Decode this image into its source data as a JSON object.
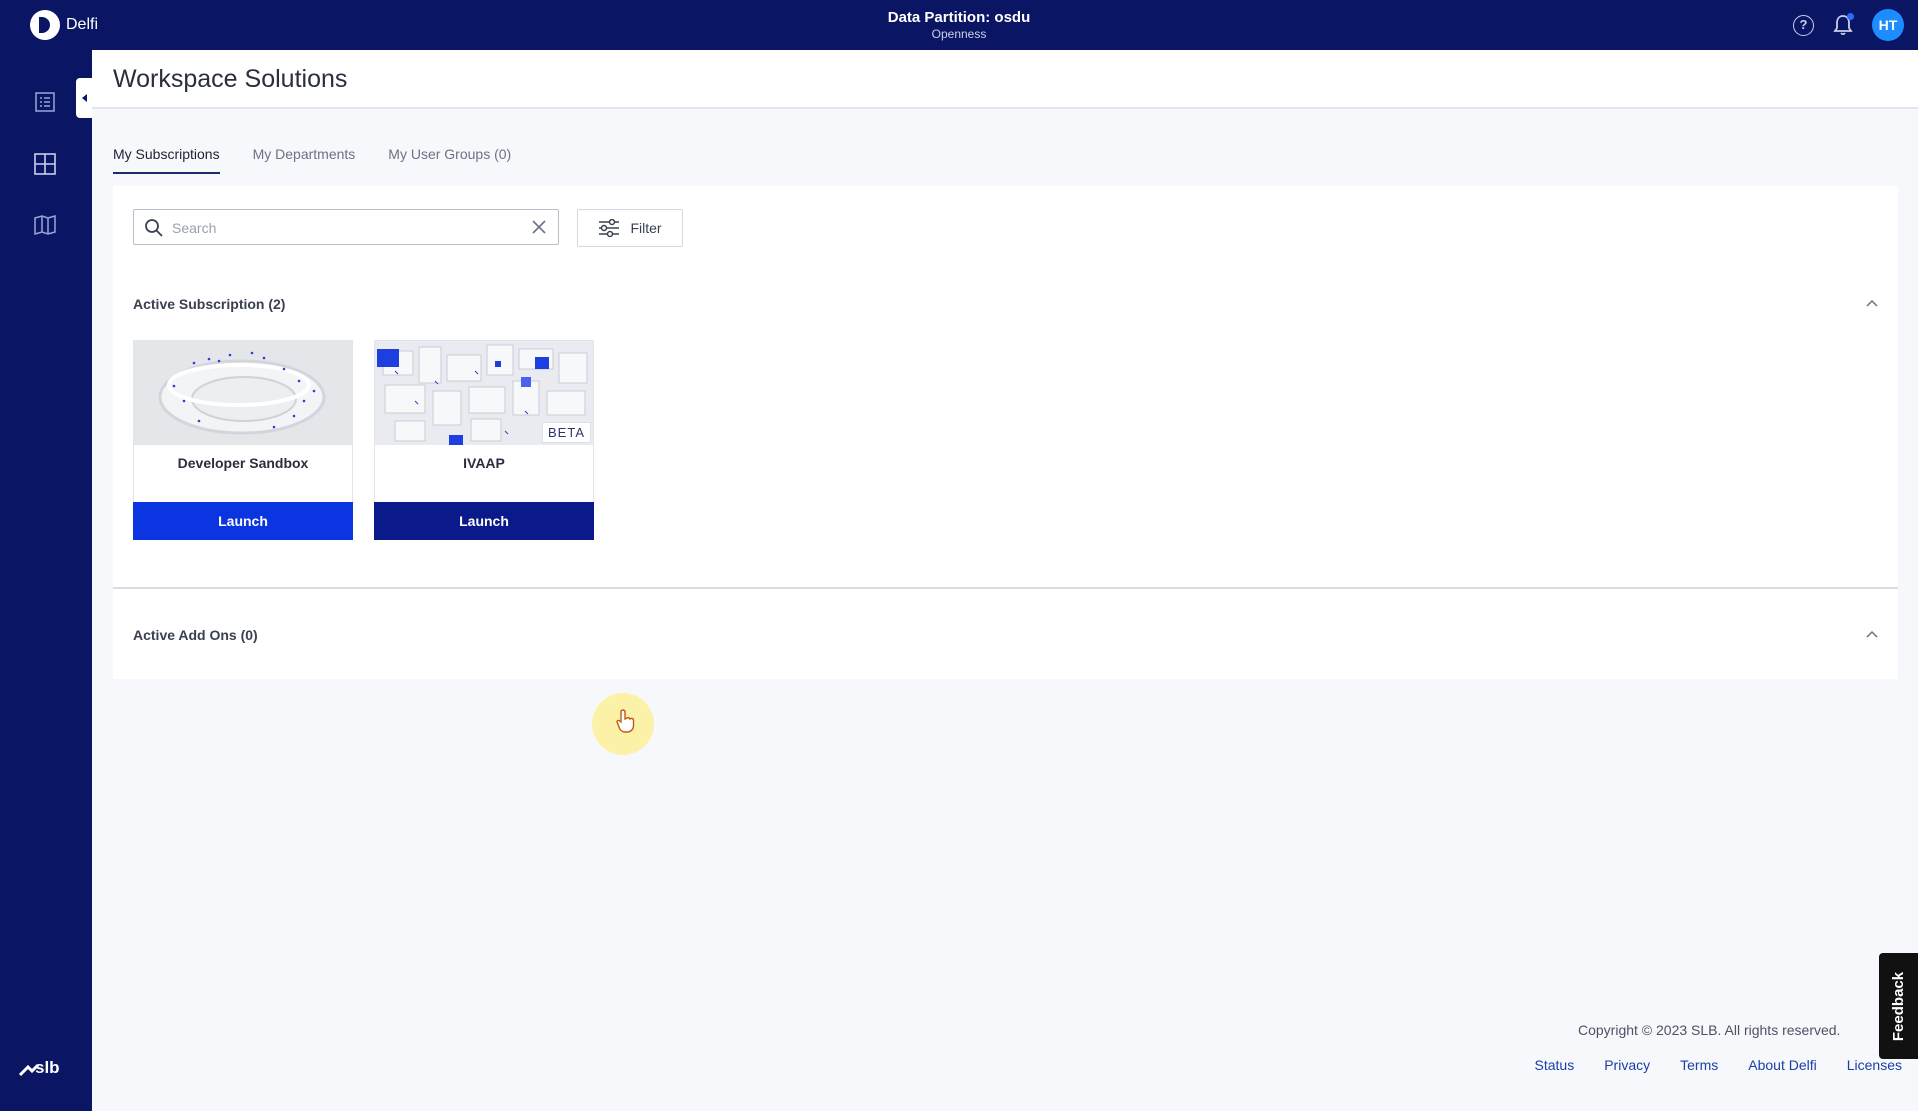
{
  "app": {
    "name": "Delfi"
  },
  "topbar": {
    "partition_title": "Data Partition: osdu",
    "partition_subtitle": "Openness",
    "avatar_initials": "HT"
  },
  "sidebar": {
    "items": [
      {
        "name": "list",
        "icon": "list-icon"
      },
      {
        "name": "grid",
        "icon": "grid-icon"
      },
      {
        "name": "book",
        "icon": "book-icon"
      }
    ],
    "footer_logo": "slb-logo"
  },
  "page": {
    "title": "Workspace Solutions"
  },
  "tabs": [
    {
      "label": "My Subscriptions",
      "active": true
    },
    {
      "label": "My Departments",
      "active": false
    },
    {
      "label": "My User Groups (0)",
      "active": false
    }
  ],
  "search": {
    "placeholder": "Search",
    "value": ""
  },
  "filter": {
    "label": "Filter"
  },
  "sections": {
    "active_subscriptions": {
      "title": "Active Subscription (2)"
    },
    "active_addons": {
      "title": "Active Add Ons (0)"
    }
  },
  "cards": [
    {
      "name": "Developer Sandbox",
      "launch_label": "Launch",
      "badge": ""
    },
    {
      "name": "IVAAP",
      "launch_label": "Launch",
      "badge": "BETA"
    }
  ],
  "footer": {
    "copyright": "Copyright © 2023 SLB. All rights reserved.",
    "links": [
      "Status",
      "Privacy",
      "Terms",
      "About Delfi",
      "Licenses"
    ]
  },
  "feedback": {
    "label": "Feedback"
  },
  "colors": {
    "nav_bg": "#0a1664",
    "launch_primary": "#0a35e0",
    "launch_hover": "#0a1a8a"
  }
}
